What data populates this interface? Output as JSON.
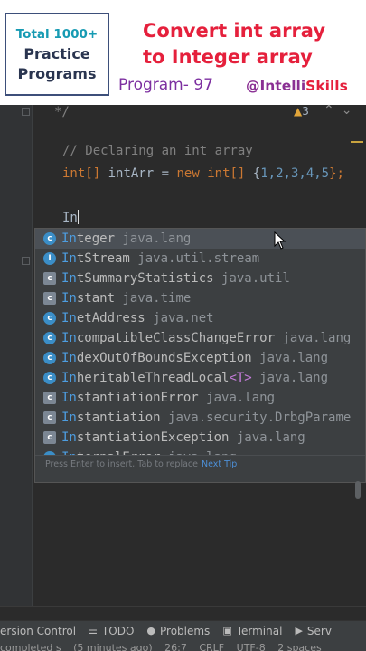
{
  "banner": {
    "badge": {
      "line1": "Total 1000+",
      "line2": "Practice",
      "line3": "Programs"
    },
    "headline": {
      "line1": "Convert int array",
      "line2": "to Integer array"
    },
    "program": "Program- 97",
    "handle": {
      "prefix": "@Intelli",
      "highlight": "Skills"
    }
  },
  "editor": {
    "top_fragment": "*/",
    "warnings": {
      "icon": "warning-triangle-icon",
      "count": "3"
    },
    "comment": "// Declaring an int array",
    "declaration": {
      "type": "int[]",
      "name": "intArr",
      "op": "=",
      "kw_new": "new",
      "new_type": "int[]",
      "brace_open": "{",
      "values": "1,2,3,4,5",
      "brace_close": "};"
    },
    "typed": "In"
  },
  "completion": {
    "items": [
      {
        "icon": "class-icon",
        "match": "In",
        "rest": "teger",
        "pkg": "java.lang",
        "selected": true
      },
      {
        "icon": "interface-icon",
        "match": "In",
        "rest": "tStream",
        "pkg": "java.util.stream"
      },
      {
        "icon": "abstract-class-icon",
        "match": "In",
        "rest": "tSummaryStatistics",
        "pkg": "java.util"
      },
      {
        "icon": "abstract-class-icon",
        "match": "In",
        "rest": "stant",
        "pkg": "java.time"
      },
      {
        "icon": "class-icon",
        "match": "In",
        "rest": "etAddress",
        "pkg": "java.net"
      },
      {
        "icon": "class-icon",
        "match": "In",
        "rest": "compatibleClassChangeError",
        "pkg": "java.lang"
      },
      {
        "icon": "class-icon",
        "match": "In",
        "rest": "dexOutOfBoundsException",
        "pkg": "java.lang"
      },
      {
        "icon": "class-icon",
        "match": "In",
        "rest": "heritableThreadLocal",
        "generic": "<T>",
        "pkg": "java.lang"
      },
      {
        "icon": "abstract-class-icon",
        "match": "In",
        "rest": "stantiationError",
        "pkg": "java.lang"
      },
      {
        "icon": "abstract-class-icon",
        "match": "In",
        "rest": "stantiation",
        "pkg": "java.security.DrbgParame"
      },
      {
        "icon": "abstract-class-icon",
        "match": "In",
        "rest": "stantiationException",
        "pkg": "java.lang"
      },
      {
        "icon": "class-icon",
        "match": "In",
        "rest": "ternalError",
        "pkg": "java.lang"
      }
    ],
    "footer": {
      "hint": "Press Enter to insert, Tab to replace",
      "tip": "Next Tip"
    }
  },
  "toolbar": {
    "items": [
      {
        "label": "ersion Control"
      },
      {
        "icon": "todo-icon",
        "label": "TODO"
      },
      {
        "icon": "problems-icon",
        "label": "Problems"
      },
      {
        "icon": "terminal-icon",
        "label": "Terminal"
      },
      {
        "icon": "services-icon",
        "label": "Serv"
      }
    ]
  },
  "statusbar": {
    "message": "completed s",
    "time": "(5 minutes ago)",
    "position": "26:7",
    "line_sep": "CRLF",
    "encoding": "UTF-8",
    "indent": "2 spaces"
  },
  "colors": {
    "accent_red": "#e5203c",
    "accent_purple": "#7c2fa0",
    "selection": "#4b5056",
    "match_highlight": "#4d9de0"
  }
}
